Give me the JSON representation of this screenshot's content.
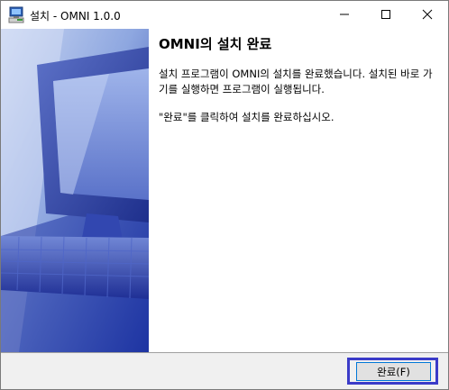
{
  "window": {
    "title": "설치 - OMNI 1.0.0",
    "controls": [
      "minimize",
      "maximize",
      "close"
    ]
  },
  "page": {
    "heading": "OMNI의 설치 완료",
    "body": "설치 프로그램이 OMNI의 설치를 완료했습니다. 설치된 바로 가기를 실행하면 프로그램이 실행됩니다.",
    "instruction": "\"완료\"를 클릭하여 설치를 완료하십시오."
  },
  "footer": {
    "finish_label": "완료(F)"
  },
  "colors": {
    "sidebar_dark": "#1a2f9a",
    "sidebar_light": "#b9c9ec",
    "highlight": "#3b3bc8",
    "button_border": "#0078d7"
  },
  "icons": {
    "app": "installer-computer-icon",
    "minimize": "minimize-icon",
    "maximize": "maximize-icon",
    "close": "close-icon"
  }
}
